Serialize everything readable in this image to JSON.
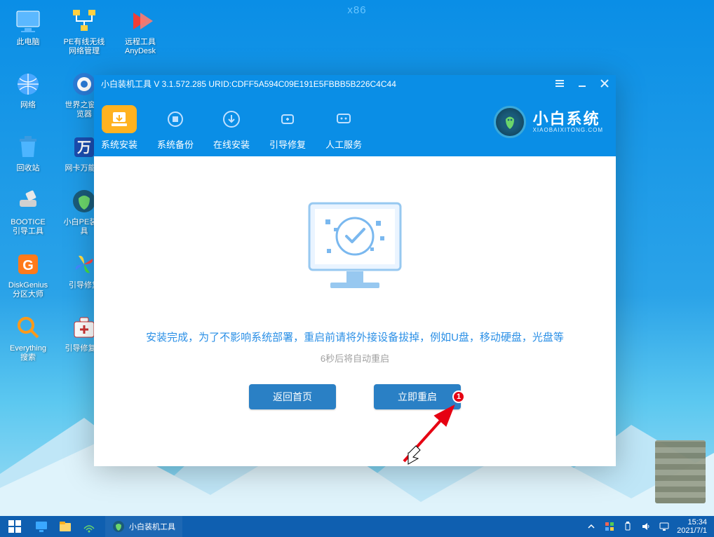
{
  "arch_label": "x86",
  "desktop": {
    "rows": [
      [
        {
          "label": "此电脑",
          "icon": "monitor"
        },
        {
          "label": "PE有线无线网络管理",
          "icon": "network"
        },
        {
          "label": "远程工具AnyDesk",
          "icon": "anydesk"
        }
      ],
      [
        {
          "label": "网络",
          "icon": "globe"
        },
        {
          "label": "世界之窗浏览器",
          "icon": "browser"
        }
      ],
      [
        {
          "label": "回收站",
          "icon": "trash"
        },
        {
          "label": "网卡万能驱",
          "icon": "wancard"
        }
      ],
      [
        {
          "label": "BOOTICE引导工具",
          "icon": "bootice"
        },
        {
          "label": "小白PE装机具",
          "icon": "xiaobaipe"
        }
      ],
      [
        {
          "label": "DiskGenius分区大师",
          "icon": "diskgenius"
        },
        {
          "label": "引导修复",
          "icon": "bootrepair"
        }
      ],
      [
        {
          "label": "Everything搜索",
          "icon": "everything"
        },
        {
          "label": "引导修复工",
          "icon": "repairkit"
        }
      ]
    ]
  },
  "window": {
    "title": "小白装机工具 V 3.1.572.285 URID:CDFF5A594C09E191E5FBBB5B226C4C44",
    "tabs": [
      {
        "label": "系统安装",
        "icon": "install",
        "active": true
      },
      {
        "label": "系统备份",
        "icon": "backup",
        "active": false
      },
      {
        "label": "在线安装",
        "icon": "online",
        "active": false
      },
      {
        "label": "引导修复",
        "icon": "repair",
        "active": false
      },
      {
        "label": "人工服务",
        "icon": "service",
        "active": false
      }
    ],
    "brand": {
      "name": "小白系统",
      "url": "XIAOBAIXITONG.COM"
    },
    "message": "安装完成，为了不影响系统部署，重启前请将外接设备拔掉，例如U盘，移动硬盘，光盘等",
    "countdown": "6秒后将自动重启",
    "actions": {
      "back": "返回首页",
      "restart": "立即重启"
    },
    "annotation": "1"
  },
  "taskbar": {
    "task_label": "小白装机工具",
    "clock": {
      "time": "15:34",
      "date": "2021/7/1"
    }
  }
}
